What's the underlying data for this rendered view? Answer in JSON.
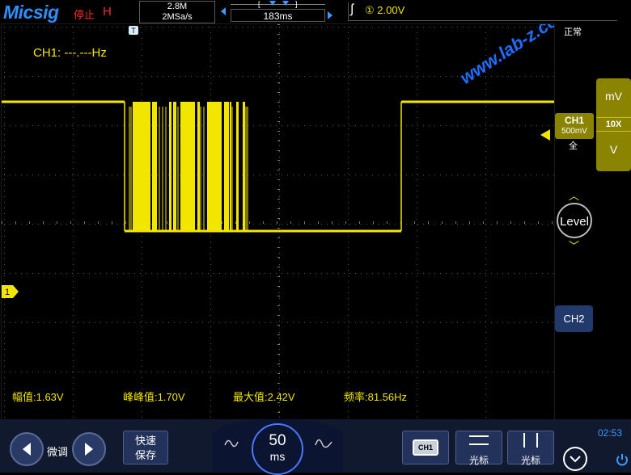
{
  "top_bar": {
    "brand": "Micsig",
    "run_state": "停止",
    "run_mode": "H",
    "memory_depth": "2.8M",
    "sample_rate": "2MSa/s",
    "horizontal_position": "183ms",
    "trigger_channel": "①",
    "trigger_level": "2.00V"
  },
  "screen": {
    "frequency_readout": "CH1: ---.---Hz",
    "watermark": "www.lab-z.com",
    "trigger_mode": "正常",
    "ch1_marker_label": "1",
    "trigger_marker_label": "T",
    "measurements": [
      {
        "label": "幅值:1.63V"
      },
      {
        "label": "峰峰值:1.70V"
      },
      {
        "label": "最大值:2.42V"
      },
      {
        "label": "频率:81.56Hz"
      }
    ]
  },
  "right_panel": {
    "vscale_unit_top": "mV",
    "vscale_probe": "10X",
    "vscale_unit_bottom": "V",
    "ch1_tag_name": "CH1",
    "ch1_tag_scale": "500mV",
    "ch1_coupling": "全",
    "level_label": "Level",
    "ch2_label": "CH2"
  },
  "bottom_bar": {
    "fine_label": "微调",
    "quick_save_line1": "快速",
    "quick_save_line2": "保存",
    "timebase_value": "50",
    "timebase_unit": "ms",
    "ch1_button_label": "CH1",
    "cursor_h_label": "光标",
    "cursor_v_label": "光标",
    "clock": "02:53"
  },
  "colors": {
    "trace": "#f2e600",
    "brand": "#2f8fff",
    "stop": "#ff2a2a",
    "panel": "#10192e",
    "channel_tag": "#8a8400"
  },
  "icons": [
    "chevron-left-icon",
    "chevron-right-icon",
    "sine-wave-icon",
    "horizontal-cursor-icon",
    "vertical-cursor-icon",
    "power-icon"
  ]
}
